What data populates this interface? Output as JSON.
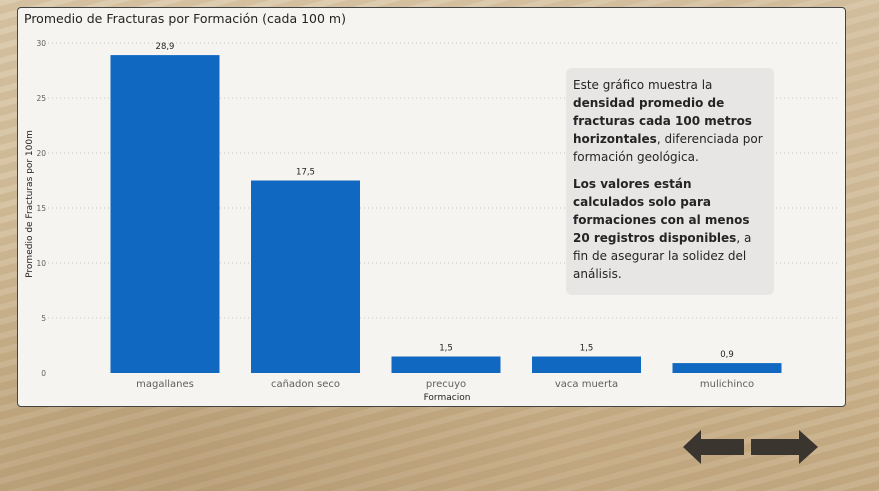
{
  "card": {
    "title": "Promedio de Fracturas por Formación (cada 100 m)"
  },
  "note": {
    "p1_a": "Este gráfico muestra la ",
    "p1_b": "densidad promedio de fracturas cada 100 metros horizontales",
    "p1_c": ", diferenciada por formación geológica.",
    "p2_a": "Los valores están calculados solo para formaciones con al menos 20 registros disponibles",
    "p2_b": ", a fin de asegurar la solidez del análisis."
  },
  "nav": {
    "back_icon": "arrow-left-icon",
    "forward_icon": "arrow-right-icon"
  },
  "chart_data": {
    "type": "bar",
    "categories": [
      "magallanes",
      "cañadon seco",
      "precuyo",
      "vaca muerta",
      "mulichinco"
    ],
    "values": [
      28.9,
      17.5,
      1.5,
      1.5,
      0.9
    ],
    "value_labels": [
      "28,9",
      "17,5",
      "1,5",
      "1,5",
      "0,9"
    ],
    "yticks": [
      0,
      5,
      10,
      15,
      20,
      25,
      30
    ],
    "ylim": [
      0,
      30
    ],
    "xlabel": "Formacion",
    "ylabel": "Promedio de Fracturas por 100m",
    "bar_color": "#1068c1",
    "grid": true
  }
}
